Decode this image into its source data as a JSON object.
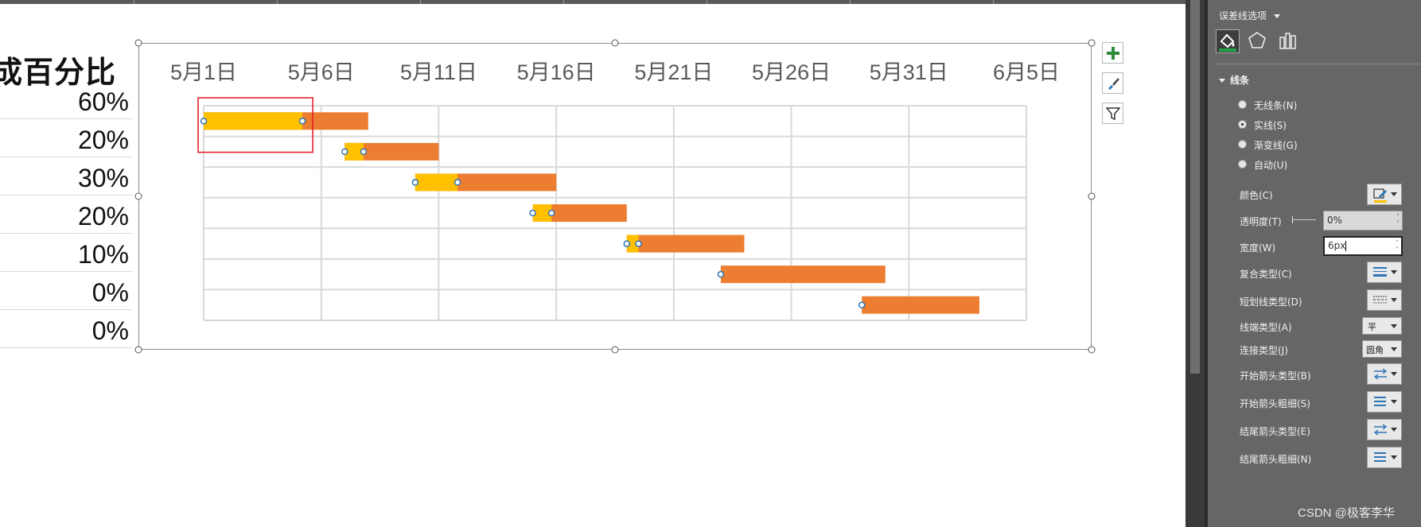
{
  "sheet": {
    "percent_header": "成百分比",
    "percent_values": [
      "60%",
      "20%",
      "30%",
      "20%",
      "10%",
      "0%",
      "0%"
    ]
  },
  "chart_data": {
    "type": "bar",
    "subtype": "gantt-stacked-horizontal",
    "x_tick_labels": [
      "5月1日",
      "5月6日",
      "5月11日",
      "5月16日",
      "5月21日",
      "5月26日",
      "5月31日",
      "6月5日"
    ],
    "xlim_days_from_may1": [
      0,
      35
    ],
    "axis_position": "top",
    "grid": true,
    "tasks": [
      {
        "start": "5月1日",
        "duration_days": 7,
        "completed_days": 4.2
      },
      {
        "start": "5月7日",
        "duration_days": 4,
        "completed_days": 0.8
      },
      {
        "start": "5月10日",
        "duration_days": 6,
        "completed_days": 1.8
      },
      {
        "start": "5月15日",
        "duration_days": 4,
        "completed_days": 0.8
      },
      {
        "start": "5月19日",
        "duration_days": 5,
        "completed_days": 0.5
      },
      {
        "start": "5月23日",
        "duration_days": 7,
        "completed_days": 0
      },
      {
        "start": "5月29日",
        "duration_days": 5,
        "completed_days": 0
      }
    ],
    "colors": {
      "completed": "#FFC000",
      "remaining": "#ED7D31",
      "grid": "#D9D9D9",
      "axis_text": "#595959",
      "selection": "#E0242B",
      "error_bar_marker": "#2E75B6"
    }
  },
  "chart_side_buttons": [
    {
      "icon": "plus-icon"
    },
    {
      "icon": "brush-icon"
    },
    {
      "icon": "filter-icon"
    }
  ],
  "panel": {
    "title": "误差线选项",
    "tabs": [
      "fill-line-icon",
      "pentagon-effects-icon",
      "bar-chart-options-icon"
    ],
    "section": "线条",
    "line_options": [
      {
        "label": "无线条(N)",
        "selected": false
      },
      {
        "label": "实线(S)",
        "selected": true
      },
      {
        "label": "渐变线(G)",
        "selected": false
      },
      {
        "label": "自动(U)",
        "selected": false
      }
    ],
    "color_label": "颜色(C)",
    "transparency_label": "透明度(T)",
    "transparency_value": "0%",
    "width_label": "宽度(W)",
    "width_value": "6px",
    "compound_label": "复合类型(C)",
    "dash_label": "短划线类型(D)",
    "cap_label": "线端类型(A)",
    "cap_value": "平",
    "join_label": "连接类型(J)",
    "join_value": "圆角",
    "begin_arrow_type_label": "开始箭头类型(B)",
    "begin_arrow_size_label": "开始箭头粗细(S)",
    "end_arrow_type_label": "结尾箭头类型(E)",
    "end_arrow_size_label": "结尾箭头粗细(N)",
    "accent": "#2E75B6"
  },
  "watermark": "CSDN @极客李华"
}
